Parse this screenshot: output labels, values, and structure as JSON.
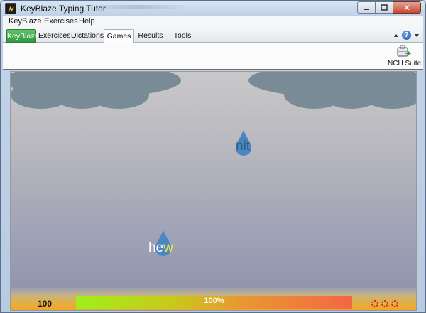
{
  "window": {
    "title": "KeyBlaze Typing Tutor",
    "controls": {
      "minimize_icon": "minimize-icon",
      "maximize_icon": "maximize-icon",
      "close_icon": "close-icon"
    }
  },
  "menu": {
    "items": [
      {
        "label": "KeyBlaze"
      },
      {
        "label": "Exercises"
      },
      {
        "label": "Help"
      }
    ]
  },
  "tabs": {
    "items": [
      {
        "label": "KeyBlaze",
        "style": "brand"
      },
      {
        "label": "Exercises"
      },
      {
        "label": "Dictations"
      },
      {
        "label": "Games",
        "active": true
      },
      {
        "label": "Results"
      },
      {
        "label": "Tools"
      }
    ],
    "help_label": "?"
  },
  "toolbar": {
    "nch_suite_label": "NCH Suite"
  },
  "game": {
    "drops": [
      {
        "typed": "",
        "current": "",
        "remaining": "nit"
      },
      {
        "typed": "he",
        "current": "w",
        "remaining": ""
      }
    ],
    "score": "100",
    "progress": {
      "label": "100%",
      "percent": 100
    },
    "lives": 3
  },
  "colors": {
    "cloud": "#7a8b98",
    "drop": "#4a86c2",
    "current_letter": "#f5e93a",
    "brand_tab": "#3aa34a"
  }
}
